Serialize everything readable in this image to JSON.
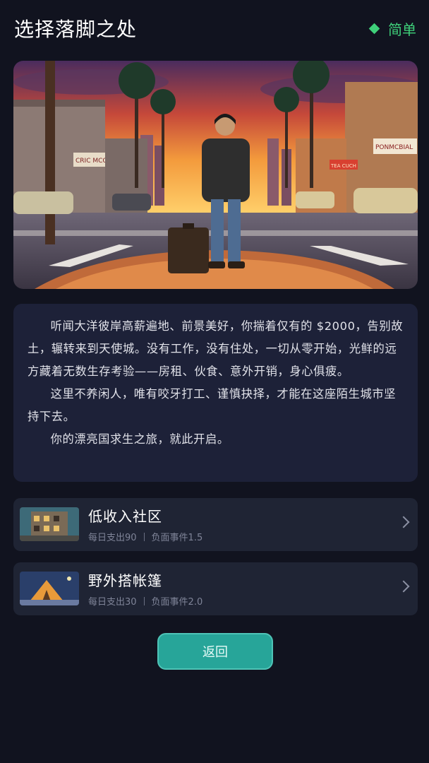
{
  "header": {
    "title": "选择落脚之处",
    "difficulty_label": "简单",
    "difficulty_color": "#3fd07a"
  },
  "hero": {
    "sign_left": "CRIC MCOY",
    "sign_right": "PONMCBIAL",
    "sign_mid": "TEA CUCH"
  },
  "story": {
    "paragraphs": [
      "听闻大洋彼岸高薪遍地、前景美好，你揣着仅有的 $2000，告别故土，辗转来到天使城。没有工作，没有住处，一切从零开始，光鲜的远方藏着无数生存考验——房租、伙食、意外开销，身心俱疲。",
      "这里不养闲人，唯有咬牙打工、谨慎抉择，才能在这座陌生城市坚持下去。",
      "你的漂亮国求生之旅，就此开启。"
    ]
  },
  "options": [
    {
      "name": "低收入社区",
      "daily_cost": "每日支出90",
      "event_factor": "负面事件1.5",
      "icon": "apartment-thumbnail"
    },
    {
      "name": "野外搭帐篷",
      "daily_cost": "每日支出30",
      "event_factor": "负面事件2.0",
      "icon": "tent-thumbnail"
    }
  ],
  "actions": {
    "back_label": "返回"
  },
  "colors": {
    "background": "#11131f",
    "panel": "#1d2138",
    "card": "#1f2434",
    "button": "#27a599"
  }
}
